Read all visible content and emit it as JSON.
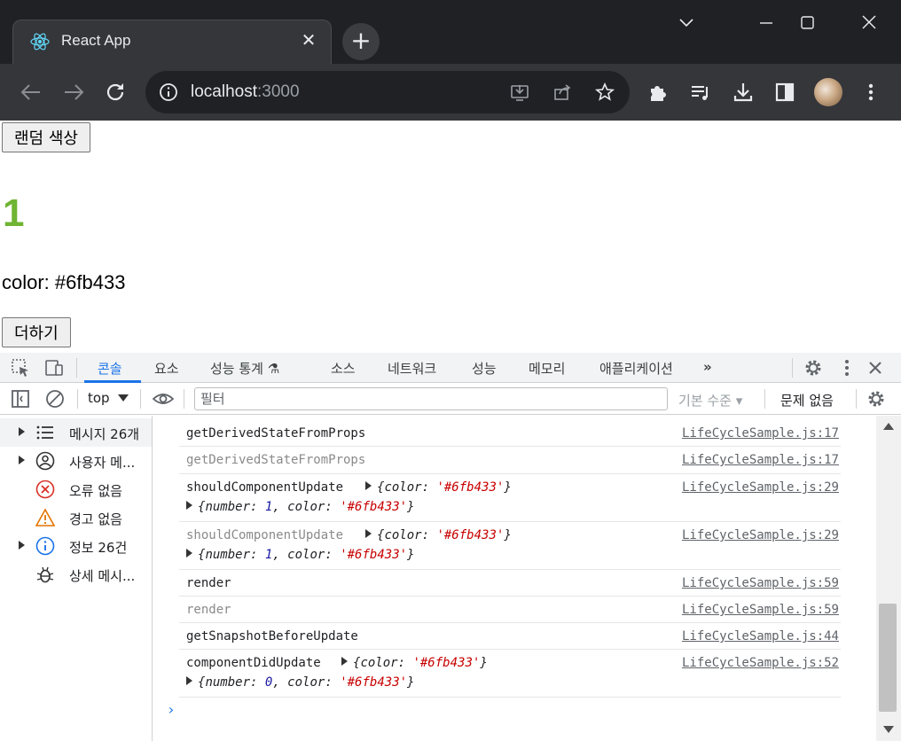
{
  "browser": {
    "tab_title": "React App",
    "url_host": "localhost",
    "url_port": ":3000"
  },
  "page": {
    "random_color_button": "랜덤 색상",
    "number": "1",
    "number_color": "#6fb433",
    "color_text": "color: #6fb433",
    "add_button": "더하기"
  },
  "devtools": {
    "tabs": [
      "콘솔",
      "요소",
      "성능 통계",
      "소스",
      "네트워크",
      "성능",
      "메모리",
      "애플리케이션"
    ],
    "context": "top",
    "filter_placeholder": "필터",
    "levels": "기본 수준",
    "issues": "문제 없음",
    "sidebar": [
      {
        "label": "메시지 26개",
        "icon": "list-icon"
      },
      {
        "label": "사용자 메...",
        "icon": "user-icon"
      },
      {
        "label": "오류 없음",
        "icon": "error-icon"
      },
      {
        "label": "경고 없음",
        "icon": "warning-icon"
      },
      {
        "label": "정보 26건",
        "icon": "info-icon"
      },
      {
        "label": "상세 메시...",
        "icon": "bug-icon"
      }
    ],
    "messages": [
      {
        "text": "getDerivedStateFromProps",
        "source": "LifeCycleSample.js:17"
      },
      {
        "text": "getDerivedStateFromProps",
        "source": "LifeCycleSample.js:17"
      },
      {
        "text": "shouldComponentUpdate",
        "source": "LifeCycleSample.js:29"
      },
      {
        "text": "shouldComponentUpdate",
        "source": "LifeCycleSample.js:29"
      },
      {
        "text": "render",
        "source": "LifeCycleSample.js:59"
      },
      {
        "text": "render",
        "source": "LifeCycleSample.js:59"
      },
      {
        "text": "getSnapshotBeforeUpdate",
        "source": "LifeCycleSample.js:44"
      },
      {
        "text": "componentDidUpdate",
        "source": "LifeCycleSample.js:52"
      }
    ],
    "obj": {
      "color_key": "color",
      "color_val": "'#6fb433'",
      "number_key": "number",
      "number_one": "1",
      "number_zero": "0"
    }
  }
}
